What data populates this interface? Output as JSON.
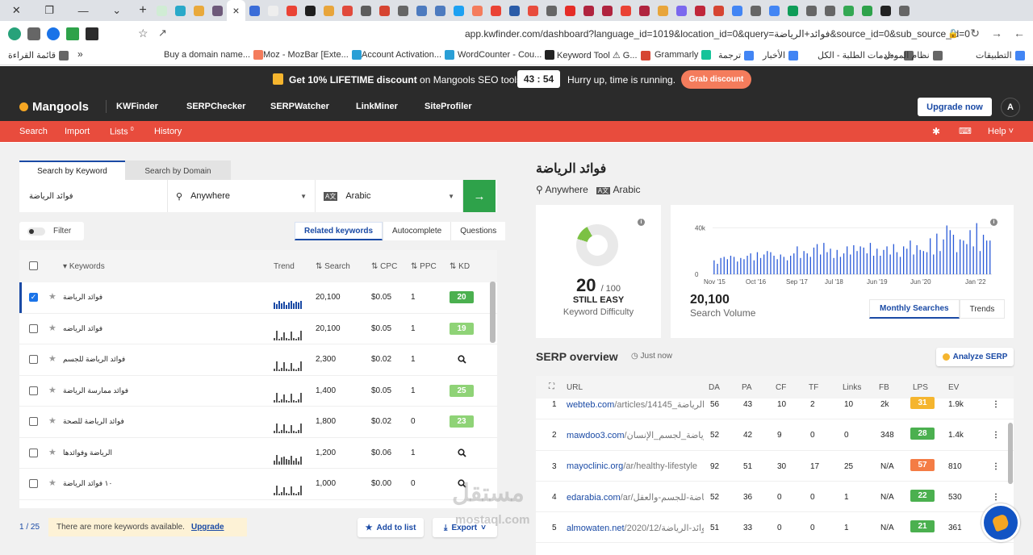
{
  "browser": {
    "tab_close": "×",
    "new_tab": "+",
    "tab_colors": [
      "#d0ecd4",
      "#2aa9c9",
      "#e9a93b",
      "#6e5a7a",
      "#3b6dd8",
      "#eee",
      "#ea4335",
      "#1f1f1f",
      "#e8a53b",
      "#e14a3c",
      "#5d5d5d",
      "#d64532",
      "#666",
      "#4d7bbf",
      "#4d7bbf",
      "#1da1f2",
      "#f47c5c",
      "#ea4335",
      "#2a5ca8",
      "#e84c3d",
      "#666",
      "#e52d27",
      "#b0243f",
      "#b0243f",
      "#ea4335",
      "#b0243f",
      "#e8a53b",
      "#7b68ee",
      "#c0273a",
      "#d64532",
      "#4285f4",
      "#666",
      "#4285f4",
      "#0f9d58",
      "#666",
      "#666",
      "#34a853",
      "#2ea24a",
      "#222",
      "#666"
    ],
    "url": "app.kwfinder.com/dashboard?language_id=1019&location_id=0&query=فوائد+الرياضة&source_id=0&sub_source_id=0",
    "bookmarks": [
      {
        "label": "قائمة القراءة",
        "color": "#666"
      },
      {
        "label": "Buy a domain name...",
        "color": "#f47c5c"
      },
      {
        "label": "Moz - MozBar [Exte...",
        "color": "#2a9fd6"
      },
      {
        "label": "Account Activation...",
        "color": "#2a9fd6"
      },
      {
        "label": "WordCounter - Cou...",
        "color": "#222"
      },
      {
        "label": "Keyword Tool ⚠ G...",
        "color": "#d64532"
      },
      {
        "label": "Grammarly",
        "color": "#15c39a"
      },
      {
        "label": "ترجمة",
        "color": "#4285f4"
      },
      {
        "label": "الأخبار",
        "color": "#4285f4"
      },
      {
        "label": "خدمات الطلبة - الكل...",
        "color": "#666"
      },
      {
        "label": "نظام المودل",
        "color": "#666"
      },
      {
        "label": "التطبيقات",
        "color": "#4285f4"
      }
    ]
  },
  "promo": {
    "text_prefix": "Get 10% LIFETIME discount",
    "text_suffix": " on Mangools SEO tools!",
    "timer": "43 : 54",
    "hurry": "Hurry up, time is running.",
    "grab": "Grab discount"
  },
  "nav": {
    "logo": "Mangools",
    "items": [
      "KWFinder",
      "SERPChecker",
      "SERPWatcher",
      "LinkMiner",
      "SiteProfiler"
    ],
    "upgrade": "Upgrade now",
    "avatar": "A"
  },
  "subnav": {
    "search": "Search",
    "import": "Import",
    "lists": "Lists",
    "lists_count": "0",
    "history": "History",
    "help": "Help"
  },
  "search": {
    "tab_keyword": "Search by Keyword",
    "tab_domain": "Search by Domain",
    "query": "فوائد الرياضة",
    "location": "Anywhere",
    "language": "Arabic",
    "go": "→"
  },
  "filter": "Filter",
  "result_tabs": [
    "Related keywords",
    "Autocomplete",
    "Questions"
  ],
  "table": {
    "headers": {
      "keywords": "Keywords",
      "trend": "Trend",
      "search": "Search",
      "cpc": "CPC",
      "ppc": "PPC",
      "kd": "KD"
    },
    "rows": [
      {
        "keyword": "فوائد الرياضة",
        "search": "20,100",
        "cpc": "$0.05",
        "ppc": "1",
        "kd": "20",
        "kd_color": "#4bb04f",
        "checked": true,
        "trend": [
          8,
          6,
          10,
          7,
          9,
          5,
          8,
          10,
          7,
          9,
          8,
          10
        ]
      },
      {
        "keyword": "فوائد الرياضه",
        "search": "20,100",
        "cpc": "$0.05",
        "ppc": "1",
        "kd": "19",
        "kd_color": "#8fd377",
        "checked": false,
        "trend": [
          3,
          12,
          2,
          4,
          10,
          3,
          2,
          11,
          3,
          2,
          4,
          12
        ]
      },
      {
        "keyword": "فوائد الرياضة للجسم",
        "search": "2,300",
        "cpc": "$0.02",
        "ppc": "1",
        "kd": "",
        "kd_color": "",
        "checked": false,
        "trend": [
          3,
          12,
          2,
          4,
          11,
          3,
          2,
          10,
          3,
          2,
          4,
          12
        ]
      },
      {
        "keyword": "فوائد ممارسة الرياضة",
        "search": "1,400",
        "cpc": "$0.05",
        "ppc": "1",
        "kd": "25",
        "kd_color": "#8fd377",
        "checked": false,
        "trend": [
          3,
          12,
          2,
          4,
          10,
          3,
          2,
          11,
          3,
          2,
          4,
          12
        ]
      },
      {
        "keyword": "فوائد الرياضة للصحة",
        "search": "1,800",
        "cpc": "$0.02",
        "ppc": "0",
        "kd": "23",
        "kd_color": "#8fd377",
        "checked": false,
        "trend": [
          3,
          12,
          2,
          4,
          11,
          3,
          2,
          10,
          3,
          2,
          4,
          12
        ]
      },
      {
        "keyword": "الرياضة وفوائدها",
        "search": "1,200",
        "cpc": "$0.06",
        "ppc": "1",
        "kd": "",
        "kd_color": "",
        "checked": false,
        "trend": [
          5,
          12,
          4,
          9,
          10,
          7,
          6,
          11,
          5,
          8,
          4,
          10
        ]
      },
      {
        "keyword": "١٠ فوائد الرياضة",
        "search": "1,000",
        "cpc": "$0.00",
        "ppc": "0",
        "kd": "",
        "kd_color": "",
        "checked": false,
        "trend": [
          3,
          12,
          2,
          4,
          10,
          3,
          2,
          11,
          3,
          2,
          4,
          12
        ]
      }
    ]
  },
  "footer": {
    "page": "1 / 25",
    "more": "There are more keywords available.",
    "upgrade": "Upgrade",
    "add": "Add to list",
    "export": "Export"
  },
  "detail": {
    "keyword": "فوائد الرياضة",
    "location": "Anywhere",
    "language": "Arabic",
    "kd_value": "20",
    "kd_max": "/ 100",
    "kd_label": "STILL EASY",
    "kd_sub": "Keyword Difficulty",
    "sv_value": "20,100",
    "sv_label": "Search Volume",
    "sv_tabs": [
      "Monthly Searches",
      "Trends"
    ]
  },
  "chart_data": {
    "type": "bar",
    "y_ticks": [
      "40k",
      "0"
    ],
    "x_ticks": [
      "Nov '15",
      "Oct '16",
      "Sep '17",
      "Jul '18",
      "Jun '19",
      "Jun '20",
      "Jan '22"
    ],
    "ylim": [
      0,
      50000
    ],
    "values": [
      12000,
      9000,
      14000,
      15000,
      13000,
      16000,
      15000,
      11000,
      14000,
      13000,
      16000,
      18000,
      12000,
      19000,
      14000,
      17000,
      20000,
      19000,
      16000,
      13000,
      17000,
      15000,
      12000,
      16000,
      18000,
      24000,
      14000,
      20000,
      18000,
      15000,
      23000,
      26000,
      17000,
      27000,
      19000,
      22000,
      14000,
      21000,
      15000,
      18000,
      24000,
      17000,
      25000,
      20000,
      24000,
      23000,
      18000,
      27000,
      16000,
      22000,
      16000,
      21000,
      24000,
      17000,
      26000,
      19000,
      15000,
      24000,
      22000,
      29000,
      17000,
      25000,
      21000,
      20000,
      19000,
      31000,
      17000,
      35000,
      20000,
      30000,
      42000,
      38000,
      34000,
      19000,
      30000,
      29000,
      26000,
      38000,
      24000,
      44000,
      20000,
      34000,
      29000,
      29000
    ]
  },
  "serp": {
    "title": "SERP overview",
    "time": "Just now",
    "analyze": "Analyze SERP",
    "headers": [
      "URL",
      "DA",
      "PA",
      "CF",
      "TF",
      "Links",
      "FB",
      "LPS",
      "EV"
    ],
    "rows": [
      {
        "n": "1",
        "domain": "webteb.com",
        "path": "/articles/14145_فوائد-الرياضة",
        "da": "56",
        "pa": "43",
        "cf": "10",
        "tf": "2",
        "links": "10",
        "fb": "2k",
        "lps": "31",
        "lps_color": "#f5b52e",
        "ev": "1.9k"
      },
      {
        "n": "2",
        "domain": "mawdoo3.com",
        "path": "/فوائد_الرياضة_لجسم_الإنسان",
        "da": "52",
        "pa": "42",
        "cf": "9",
        "tf": "0",
        "links": "0",
        "fb": "348",
        "lps": "28",
        "lps_color": "#4bb04f",
        "ev": "1.4k"
      },
      {
        "n": "3",
        "domain": "mayoclinic.org",
        "path": "/ar/healthy-lifestyle",
        "da": "92",
        "pa": "51",
        "cf": "30",
        "tf": "17",
        "links": "25",
        "fb": "N/A",
        "lps": "57",
        "lps_color": "#f47c45",
        "ev": "810"
      },
      {
        "n": "4",
        "domain": "edarabia.com",
        "path": "/ar/فوائد-الرياضة-للجسم-والعقل",
        "da": "52",
        "pa": "36",
        "cf": "0",
        "tf": "0",
        "links": "1",
        "fb": "N/A",
        "lps": "22",
        "lps_color": "#4bb04f",
        "ev": "530"
      },
      {
        "n": "5",
        "domain": "almowaten.net",
        "path": "/2020/12/فوائد-الرياضة",
        "da": "51",
        "pa": "33",
        "cf": "0",
        "tf": "0",
        "links": "1",
        "fb": "N/A",
        "lps": "21",
        "lps_color": "#4bb04f",
        "ev": "361"
      }
    ]
  },
  "watermark": {
    "ar": "مستقل",
    "en": "mostaql.com"
  }
}
